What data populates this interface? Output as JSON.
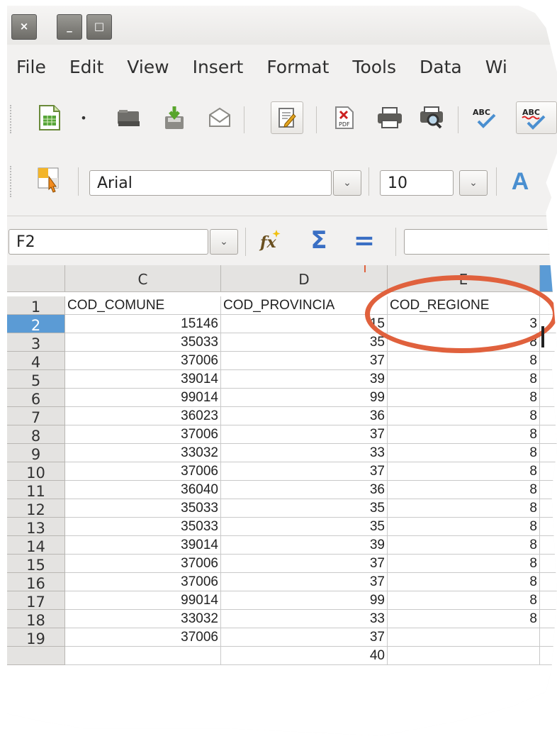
{
  "window": {
    "close_glyph": "×",
    "minimize_glyph": "_",
    "maximize_glyph": "□"
  },
  "menu": [
    "File",
    "Edit",
    "View",
    "Insert",
    "Format",
    "Tools",
    "Data",
    "Wi"
  ],
  "toolbar_icons": [
    "new-spreadsheet-icon",
    "dropdown-arrow-icon",
    "open-folder-icon",
    "save-icon",
    "email-icon",
    "edit-file-icon",
    "export-pdf-icon",
    "print-icon",
    "print-preview-icon",
    "spellcheck-icon",
    "autospellcheck-icon"
  ],
  "format": {
    "font_name": "Arial",
    "font_size": "10",
    "text_a_glyph": "A"
  },
  "formula": {
    "name_box": "F2",
    "sum_glyph": "Σ",
    "equals_glyph": "="
  },
  "grid": {
    "columns": [
      "C",
      "D",
      "E"
    ],
    "header_row": {
      "row": "1",
      "cells": [
        "COD_COMUNE",
        "COD_PROVINCIA",
        "COD_REGIONE"
      ]
    },
    "rows": [
      {
        "row": "2",
        "cells": [
          "15146",
          "15",
          "3"
        ]
      },
      {
        "row": "3",
        "cells": [
          "35033",
          "35",
          "8"
        ]
      },
      {
        "row": "4",
        "cells": [
          "37006",
          "37",
          "8"
        ]
      },
      {
        "row": "5",
        "cells": [
          "39014",
          "39",
          "8"
        ]
      },
      {
        "row": "6",
        "cells": [
          "99014",
          "99",
          "8"
        ]
      },
      {
        "row": "7",
        "cells": [
          "36023",
          "36",
          "8"
        ]
      },
      {
        "row": "8",
        "cells": [
          "37006",
          "37",
          "8"
        ]
      },
      {
        "row": "9",
        "cells": [
          "33032",
          "33",
          "8"
        ]
      },
      {
        "row": "10",
        "cells": [
          "37006",
          "37",
          "8"
        ]
      },
      {
        "row": "11",
        "cells": [
          "36040",
          "36",
          "8"
        ]
      },
      {
        "row": "12",
        "cells": [
          "35033",
          "35",
          "8"
        ]
      },
      {
        "row": "13",
        "cells": [
          "35033",
          "35",
          "8"
        ]
      },
      {
        "row": "14",
        "cells": [
          "39014",
          "39",
          "8"
        ]
      },
      {
        "row": "15",
        "cells": [
          "37006",
          "37",
          "8"
        ]
      },
      {
        "row": "16",
        "cells": [
          "37006",
          "37",
          "8"
        ]
      },
      {
        "row": "17",
        "cells": [
          "99014",
          "99",
          "8"
        ]
      },
      {
        "row": "18",
        "cells": [
          "33032",
          "33",
          "8"
        ]
      },
      {
        "row": "19",
        "cells": [
          "37006",
          "37",
          ""
        ]
      },
      {
        "row": "",
        "cells": [
          "",
          "40",
          ""
        ]
      }
    ]
  },
  "colors": {
    "highlight": "#e0613d",
    "selected_row": "#5b9bd5"
  }
}
